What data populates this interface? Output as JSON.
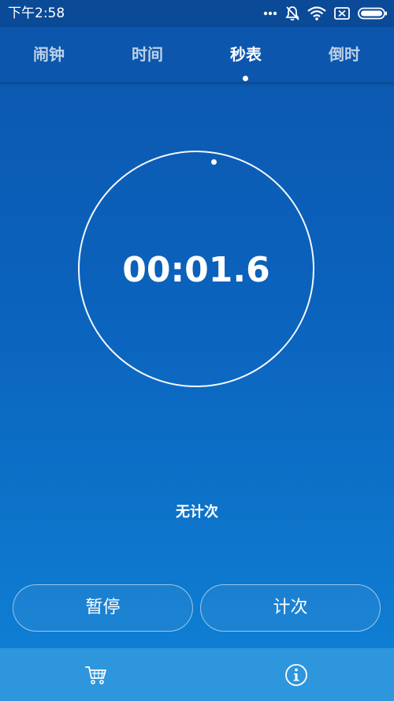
{
  "status_bar": {
    "time": "下午2:58",
    "icons": [
      "more-dots-icon",
      "mute-bell-icon",
      "wifi-icon",
      "no-sim-icon",
      "battery-icon"
    ]
  },
  "tabs": [
    {
      "label": "闹钟",
      "active": false
    },
    {
      "label": "时间",
      "active": false
    },
    {
      "label": "秒表",
      "active": true
    },
    {
      "label": "倒时",
      "active": false
    }
  ],
  "stopwatch": {
    "elapsed": "00:01.6",
    "laps_empty_text": "无计次"
  },
  "buttons": {
    "pause_label": "暂停",
    "lap_label": "计次"
  },
  "bottom_bar": {
    "icons": [
      "cart-icon",
      "info-icon"
    ]
  },
  "colors": {
    "status_bar": "#0a4a97",
    "header": "#0c56ad",
    "background_top": "#0c56ad",
    "background_bottom": "#0f82d6",
    "bottom_bar": "#2e96dc",
    "foreground": "#ffffff"
  }
}
